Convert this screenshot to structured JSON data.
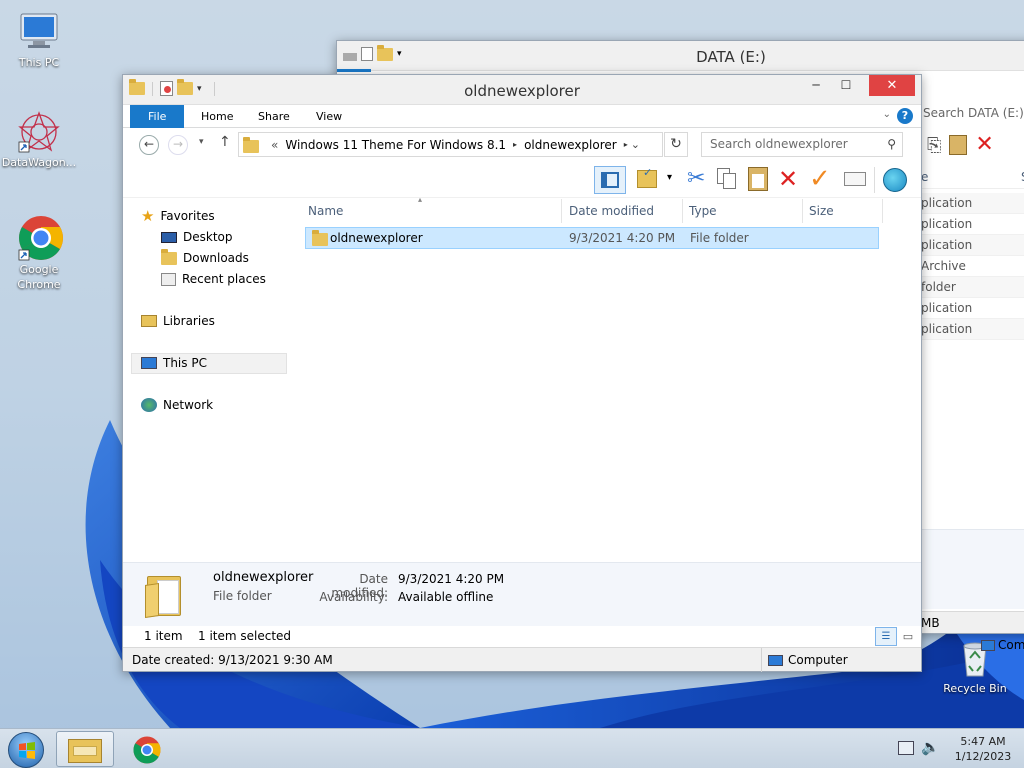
{
  "desktop": {
    "icons": [
      {
        "label": "This PC",
        "icon": "monitor-icon"
      },
      {
        "label": "DataWagon...",
        "icon": "datawagon-icon"
      },
      {
        "label": "Google Chrome",
        "icon": "chrome-icon"
      },
      {
        "label": "Recycle Bin",
        "icon": "recycle-bin-icon"
      }
    ]
  },
  "back_window": {
    "title": "DATA (E:)",
    "search_placeholder": "Search DATA (E:)",
    "type_rows": [
      "plication",
      "plication",
      "plication",
      "Archive",
      "folder",
      "plication",
      "plication"
    ],
    "col_type": "e",
    "col_s": "S",
    "status_mb": "MB",
    "status_computer": "Com"
  },
  "window": {
    "title": "oldnewexplorer",
    "tabs": [
      "File",
      "Home",
      "Share",
      "View"
    ],
    "breadcrumb": {
      "prefix": "«",
      "parts": [
        "Windows 11 Theme For Windows 8.1",
        "oldnewexplorer"
      ]
    },
    "search_placeholder": "Search oldnewexplorer",
    "nav": {
      "favorites": "Favorites",
      "desktop": "Desktop",
      "downloads": "Downloads",
      "recent": "Recent places",
      "libraries": "Libraries",
      "thispc": "This PC",
      "network": "Network"
    },
    "columns": {
      "name": "Name",
      "date": "Date modified",
      "type": "Type",
      "size": "Size"
    },
    "files": [
      {
        "name": "oldnewexplorer",
        "date": "9/3/2021 4:20 PM",
        "type": "File folder",
        "size": ""
      }
    ],
    "details": {
      "name": "oldnewexplorer",
      "kind": "File folder",
      "date_label": "Date modified:",
      "date_value": "9/3/2021 4:20 PM",
      "avail_label": "Availability:",
      "avail_value": "Available offline"
    },
    "status": {
      "count": "1 item",
      "selected": "1 item selected"
    },
    "info": {
      "created": "Date created: 9/13/2021 9:30 AM",
      "location": "Computer"
    }
  },
  "taskbar": {
    "time": "5:47 AM",
    "date": "1/12/2023"
  },
  "colors": {
    "file_tab": "#1979ca",
    "selection": "#cce8ff",
    "close_btn": "#e04343"
  }
}
